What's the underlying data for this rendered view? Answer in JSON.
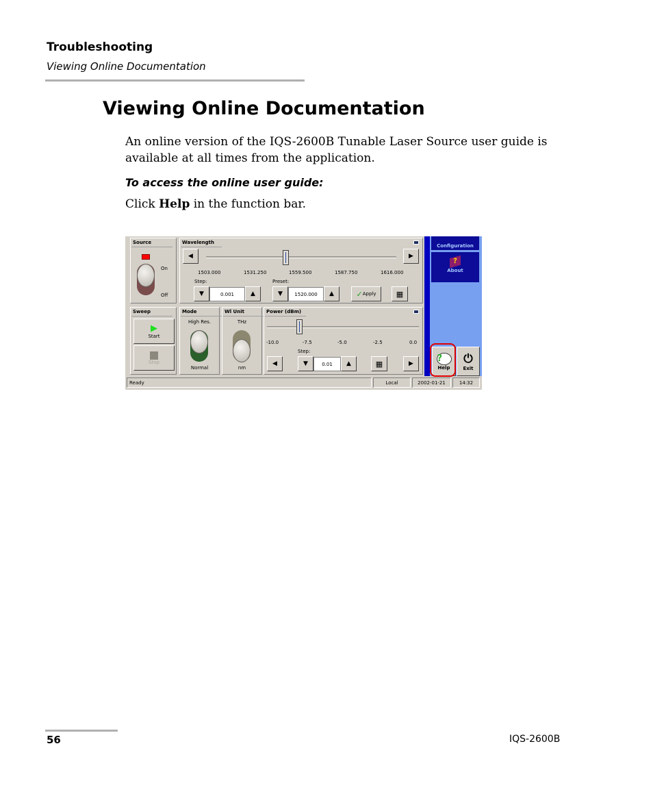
{
  "header": {
    "section": "Troubleshooting",
    "subsection": "Viewing Online Documentation"
  },
  "title": "Viewing Online Documentation",
  "intro": "An online version of the IQS-2600B Tunable Laser Source user guide is available at all times from the application.",
  "procedure_title": "To access the online user guide:",
  "step": {
    "pre": "Click ",
    "bold": "Help",
    "post": " in the function bar."
  },
  "app": {
    "source": {
      "title": "Source",
      "on": "On",
      "off": "Off",
      "led_color": "#ff0000"
    },
    "wavelength": {
      "title": "Wavelength",
      "ticks": [
        "1503.000",
        "1531.250",
        "1559.500",
        "1587.750",
        "1616.000"
      ],
      "step_label": "Step:",
      "step_value": "0.001",
      "preset_label": "Preset:",
      "preset_value": "1520.000",
      "apply": "Apply"
    },
    "sweep": {
      "title": "Sweep",
      "start": "Start",
      "stop": "Stop"
    },
    "mode": {
      "title": "Mode",
      "top": "High Res.",
      "bottom": "Normal"
    },
    "wl_unit": {
      "title": "Wl Unit",
      "top": "THz",
      "bottom": "nm"
    },
    "power": {
      "title": "Power (dBm)",
      "ticks": [
        "-10.0",
        "-7.5",
        "-5.0",
        "-2.5",
        "0.0"
      ],
      "step_label": "Step:",
      "step_value": "0.01"
    },
    "function_bar": {
      "configuration": "Configuration",
      "about": "About",
      "help": "Help",
      "exit": "Exit",
      "highlight_color": "#e00000"
    },
    "status": {
      "message": "Ready",
      "mode": "Local",
      "date": "2002-01-21",
      "time": "14:32"
    }
  },
  "footer": {
    "page": "56",
    "product": "IQS-2600B"
  }
}
